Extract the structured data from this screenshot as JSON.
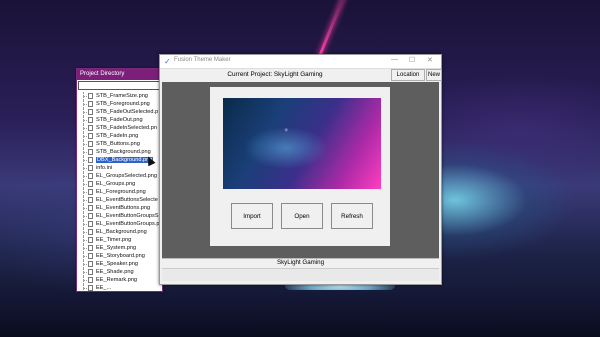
{
  "directory": {
    "title": "Project Directory",
    "items": [
      "STB_FrameSize.png",
      "STB_Foreground.png",
      "STB_FadeOutSelected.p",
      "STB_FadeOut.png",
      "STB_FadeInSelected.pn",
      "STB_FadeIn.png",
      "STB_Buttons.png",
      "STB_Background.png",
      "DBX_Background.png",
      "info.ini",
      "EL_GroupsSelected.png",
      "EL_Groups.png",
      "EL_Foreground.png",
      "EL_EventButtonsSelecte",
      "EL_EventButtons.png",
      "EL_EventButtonGroupsS",
      "EL_EventButtonGroups.p",
      "EL_Background.png",
      "EE_Timer.png",
      "EE_System.png",
      "EE_Storyboard.png",
      "EE_Speaker.png",
      "EE_Shade.png",
      "EE_Remark.png",
      "EE_..."
    ],
    "selected_index": 8
  },
  "window": {
    "title": "Fusion Theme Maker",
    "current_project": "Current Project: SkyLight Gaming",
    "location_label": "Location",
    "new_label": "New",
    "import_label": "Import",
    "open_label": "Open",
    "refresh_label": "Refresh",
    "status": "SkyLight Gaming",
    "controls": {
      "minimize": "—",
      "maximize": "☐",
      "close": "✕"
    }
  }
}
